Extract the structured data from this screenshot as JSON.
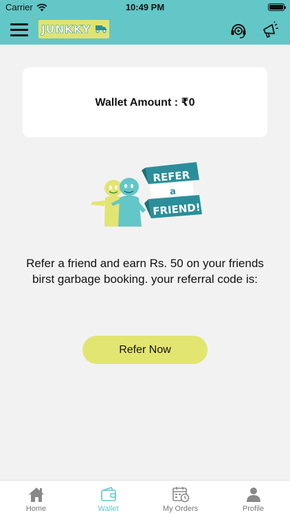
{
  "status_bar": {
    "carrier": "Carrier",
    "time": "10:49 PM"
  },
  "header": {
    "logo_text": "JUNKKY"
  },
  "wallet": {
    "amount_text": "Wallet Amount : ₹0"
  },
  "illustration": {
    "line1": "REFER",
    "line2": "a",
    "line3": "FRIEND!"
  },
  "refer": {
    "message": "Refer a friend and earn Rs. 50 on your friends birst garbage booking. your referral code is:",
    "button_label": "Refer Now"
  },
  "bottom_nav": {
    "items": [
      {
        "label": "Home",
        "icon": "home-icon",
        "active": false
      },
      {
        "label": "Wallet",
        "icon": "wallet-icon",
        "active": true
      },
      {
        "label": "My Orders",
        "icon": "calendar-clock-icon",
        "active": false
      },
      {
        "label": "Profile",
        "icon": "person-icon",
        "active": false
      }
    ]
  },
  "colors": {
    "accent": "#63c7c7",
    "button": "#e3e571",
    "inactive": "#777777"
  }
}
